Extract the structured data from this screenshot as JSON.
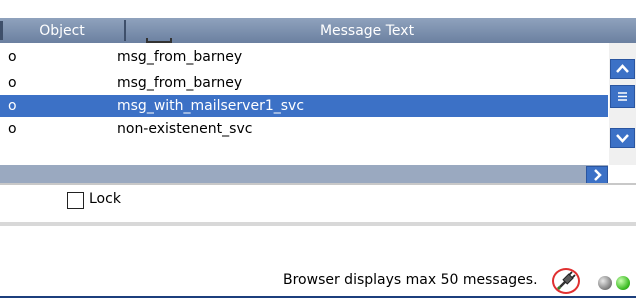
{
  "grid": {
    "columns": [
      "Object",
      "Message Text"
    ],
    "rows": [
      {
        "object": "o",
        "message": "msg_from_barney",
        "selected": false
      },
      {
        "object": "o",
        "message": "msg_from_barney",
        "selected": false
      },
      {
        "object": "o",
        "message": "msg_with_mailserver1_svc",
        "selected": true
      },
      {
        "object": "o",
        "message": "non-existenent_svc",
        "selected": false
      }
    ]
  },
  "lock": {
    "label": "Lock",
    "checked": false
  },
  "status": {
    "text": "Browser displays max 50 messages.",
    "lights": [
      "grey",
      "green"
    ]
  },
  "icons": {
    "scroll_up": "chevron-up-icon",
    "scroll_down": "chevron-down-icon",
    "scroll_thumb": "grip-icon",
    "scroll_right": "chevron-right-icon",
    "connection": "plug-icon"
  },
  "colors": {
    "header": "#6b80a0",
    "selection": "#3c71c6",
    "status_green": "#3bbb22"
  }
}
